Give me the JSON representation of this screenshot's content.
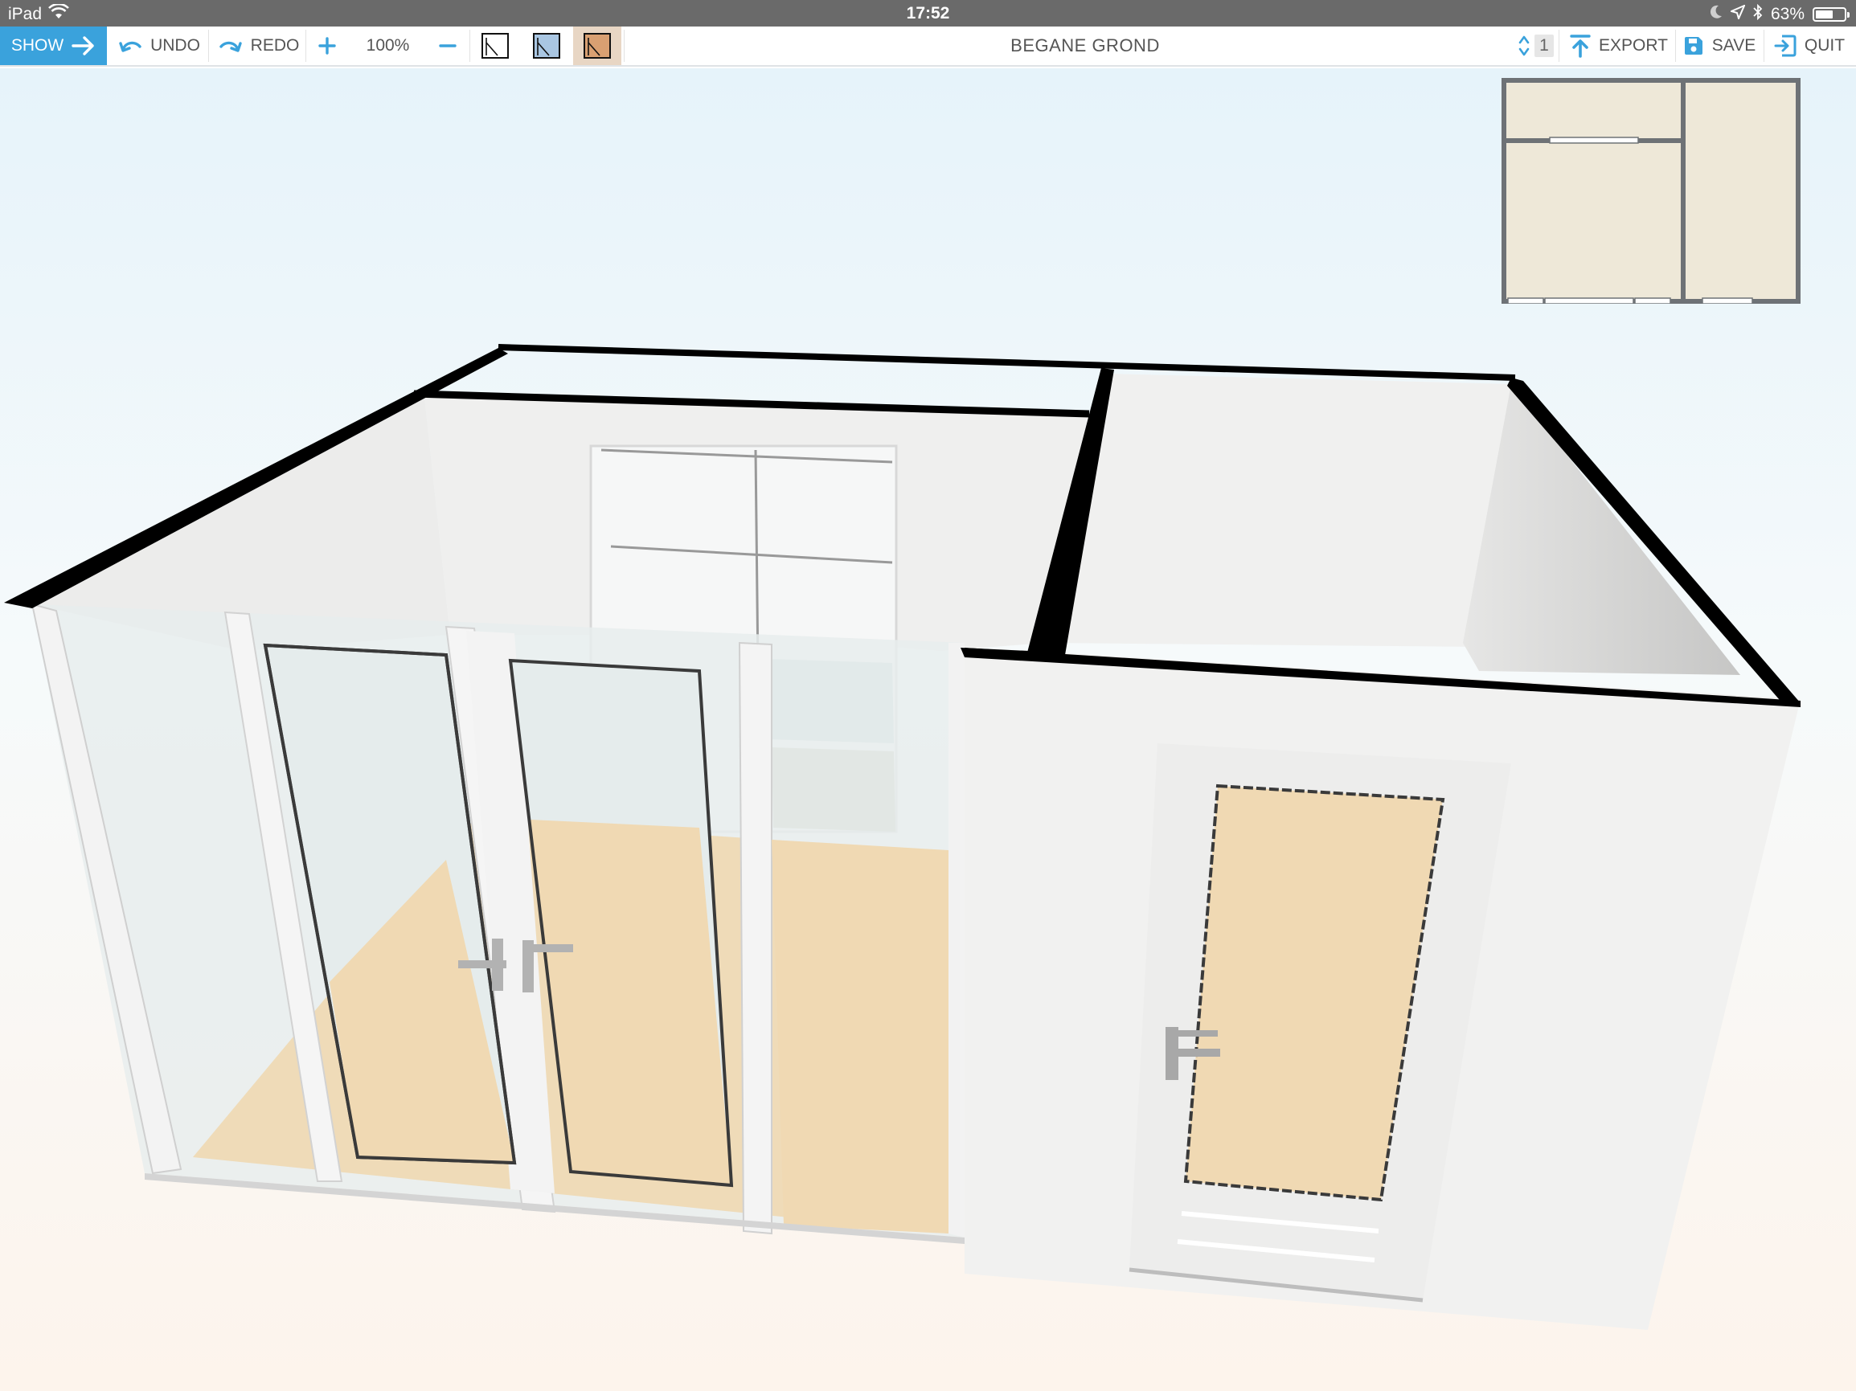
{
  "status_bar": {
    "device": "iPad",
    "time": "17:52",
    "battery_percent": "63%",
    "battery_level": 0.63,
    "icons": [
      "wifi-icon",
      "moon-icon",
      "location-icon",
      "bluetooth-icon",
      "battery-icon"
    ]
  },
  "toolbar": {
    "show_label": "SHOW",
    "undo_label": "UNDO",
    "redo_label": "REDO",
    "zoom_level": "100%",
    "title": "BEGANE GROND",
    "floor_number": "1",
    "export_label": "EXPORT",
    "save_label": "SAVE",
    "quit_label": "QUIT",
    "accent_color": "#3aa2dc",
    "view_modes": [
      {
        "name": "2d-view",
        "color": "#ffffff"
      },
      {
        "name": "blueprint-view",
        "color": "#a9c6e2"
      },
      {
        "name": "3d-view",
        "color": "#d9a072",
        "selected": true
      }
    ]
  },
  "scene": {
    "floor_color": "#f0d9b3",
    "wall_color": "#f1f1f0",
    "wall_top_color": "#000000",
    "glass_color": "#e6eeee"
  },
  "minimap": {
    "room_color": "#eee8d8",
    "wall_color": "#6e7276"
  }
}
